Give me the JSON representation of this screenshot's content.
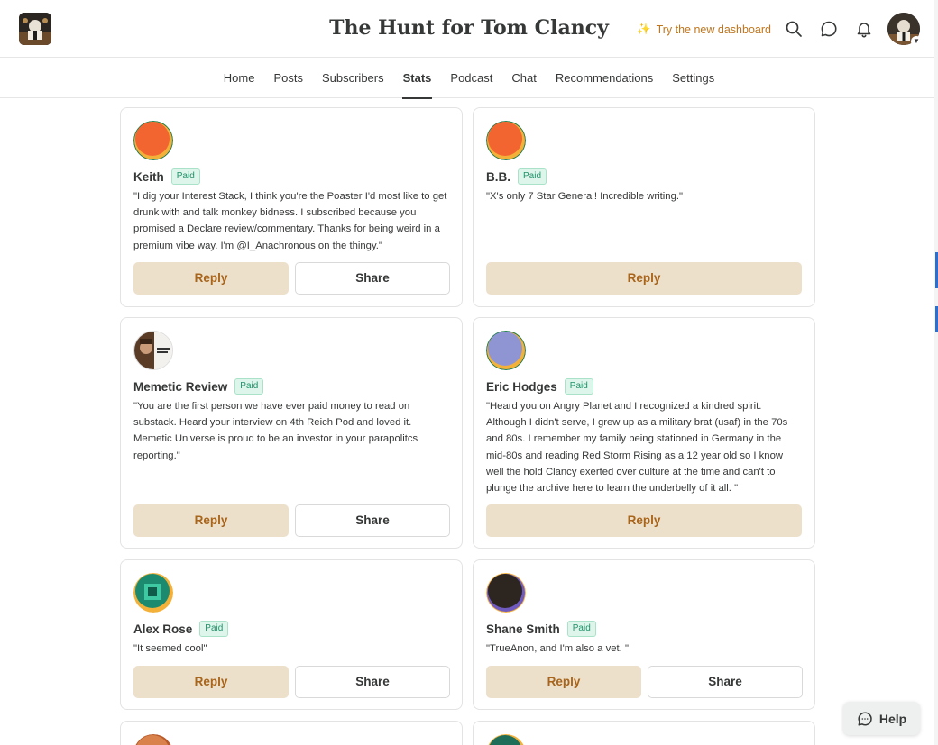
{
  "header": {
    "publication_title": "The Hunt for Tom Clancy",
    "try_dashboard_label": "Try the new dashboard",
    "sparkle_glyph": "✨",
    "icons": [
      "search-icon",
      "chat-bubble-icon",
      "bell-icon"
    ]
  },
  "nav": {
    "items": [
      {
        "label": "Home"
      },
      {
        "label": "Posts"
      },
      {
        "label": "Subscribers"
      },
      {
        "label": "Stats",
        "active": true
      },
      {
        "label": "Podcast"
      },
      {
        "label": "Chat"
      },
      {
        "label": "Recommendations"
      },
      {
        "label": "Settings"
      }
    ]
  },
  "cards": [
    {
      "name": "Keith",
      "badge": "Paid",
      "avatar": "orange-gradient",
      "message": "\"I dig your Interest Stack, I think you're the Poaster I'd most like to get drunk with and talk monkey bidness. I subscribed because you promised a Declare review/commentary. Thanks for being weird in a premium vibe way. I'm @I_Anachronous on the thingy.\"",
      "reply_label": "Reply",
      "share_label": "Share"
    },
    {
      "name": "B.B.",
      "badge": "Paid",
      "avatar": "orange-gradient",
      "message": "\"X's only 7 Star General! Incredible writing.\"",
      "reply_label": "Reply"
    },
    {
      "name": "Memetic Review",
      "badge": "Paid",
      "avatar": "memetic-photo",
      "message": "\"You are the first person we have ever paid money to read on substack. Heard your interview on 4th Reich Pod and loved it. Memetic Universe is proud to be an investor in your parapolitcs reporting.\"",
      "reply_label": "Reply",
      "share_label": "Share"
    },
    {
      "name": "Eric Hodges",
      "badge": "Paid",
      "avatar": "lavender-gradient",
      "message": "\"Heard you on Angry Planet and I recognized a kindred spirit. Although I didn't serve, I grew up as a military brat (usaf) in the 70s and 80s. I remember my family being stationed in Germany in the mid-80s and reading Red Storm Rising as a 12 year old so I know well the hold Clancy exerted over culture at the time and can't to plunge the archive here to learn the underbelly of it all. \"",
      "reply_label": "Reply"
    },
    {
      "name": "Alex Rose",
      "badge": "Paid",
      "avatar": "green-photo",
      "message": "\"It seemed cool\"",
      "reply_label": "Reply",
      "share_label": "Share"
    },
    {
      "name": "Shane Smith",
      "badge": "Paid",
      "avatar": "dark-gradient",
      "message": "\"TrueAnon, and I'm also a vet. \"",
      "reply_label": "Reply",
      "share_label": "Share"
    }
  ],
  "help": {
    "label": "Help",
    "icon": "chat-bubble-icon"
  },
  "colors": {
    "reply_bg": "#ede0cb",
    "reply_text": "#a8641a",
    "paid_badge_text": "#20926b",
    "paid_badge_bg": "#ddf5ea",
    "accent_orange": "#c0751b"
  }
}
